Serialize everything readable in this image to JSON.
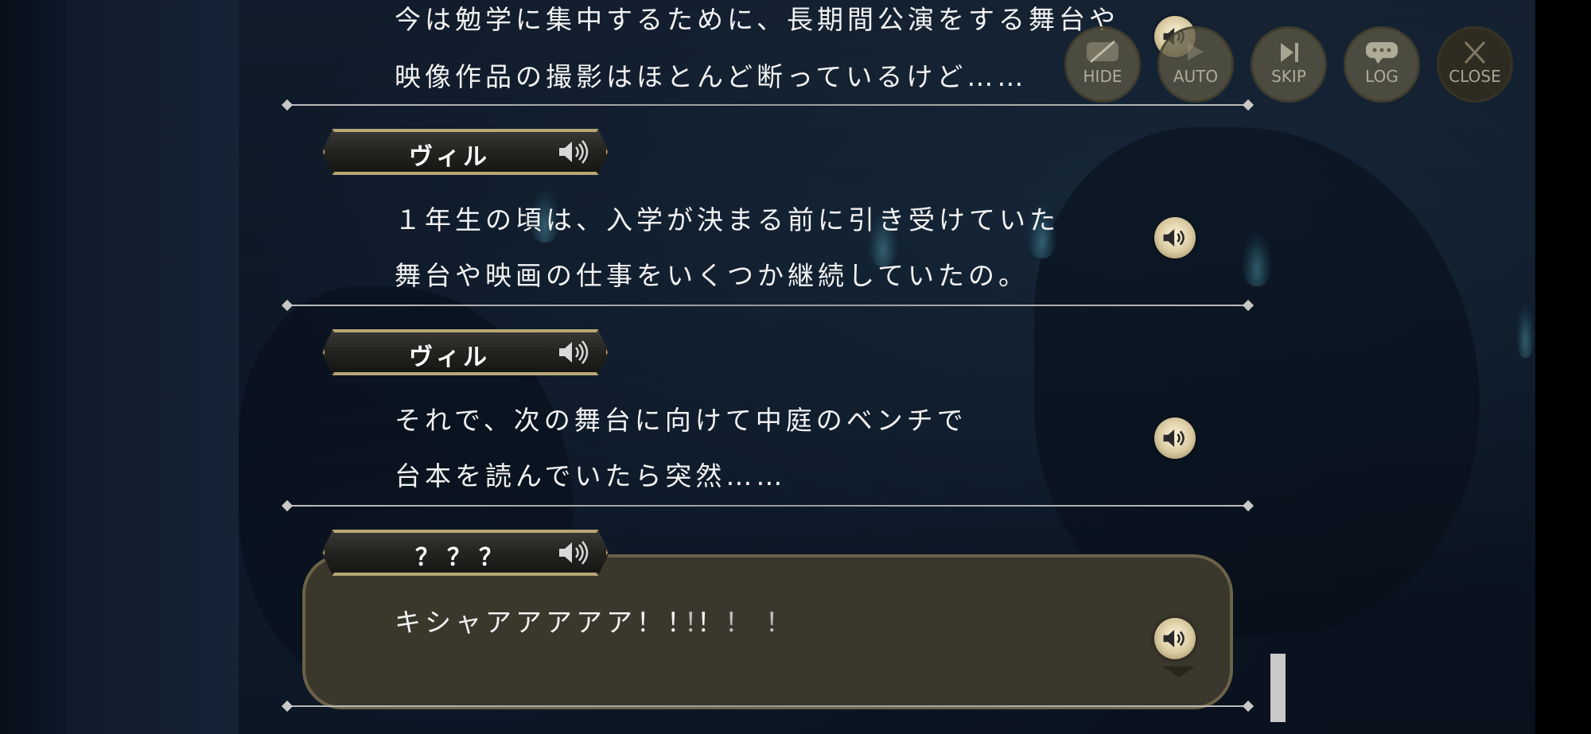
{
  "menu": {
    "hide_label": "HIDE",
    "auto_label": "AUTO",
    "skip_label": "SKIP",
    "log_label": "LOG",
    "close_label": "CLOSE"
  },
  "log": {
    "entries": [
      {
        "speaker": "",
        "lines": [
          "今は勉学に集中するために、長期間公演をする舞台や",
          "映像作品の撮影はほとんど断っているけど……"
        ]
      },
      {
        "speaker": "ヴィル",
        "lines": [
          "１年生の頃は、入学が決まる前に引き受けていた",
          "舞台や映画の仕事をいくつか継続していたの。"
        ]
      },
      {
        "speaker": "ヴィル",
        "lines": [
          "それで、次の舞台に向けて中庭のベンチで",
          "台本を読んでいたら突然……"
        ]
      },
      {
        "speaker": "？？？",
        "lines": [
          "キシャアアアアア！！！",
          "！！！"
        ]
      }
    ]
  },
  "icons": {
    "voice": "speaker-volume-icon",
    "hide": "eye-slash-icon",
    "auto": "auto-play-icon",
    "skip": "skip-forward-icon",
    "log": "chat-bubble-icon",
    "close": "close-x-icon"
  },
  "colors": {
    "nameplate_border": "#b9a877",
    "current_box": "#413c2d",
    "text": "#f2f2f2"
  }
}
